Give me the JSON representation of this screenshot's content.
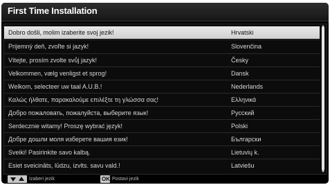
{
  "title": "First Time Installation",
  "languages": [
    {
      "welcome": "Dobro došli, molim izaberite svoj jezik!",
      "language": "Hrvatski",
      "selected": true
    },
    {
      "welcome": "Prijemný deň, zvoľte si jazyk!",
      "language": "Slovenčina"
    },
    {
      "welcome": "Vítejte, prosím zvolte svůj jazyk!",
      "language": "Česky"
    },
    {
      "welcome": "Velkommen, vælg venligst et sprog!",
      "language": "Dansk"
    },
    {
      "welcome": "Welkom, selecteer uw taal A.U.B.!",
      "language": "Nederlands"
    },
    {
      "welcome": "Καλώς ήλθατε, παρακαλούμε επιλέξτε τη γλώσσα σας!",
      "language": "Ελληνικά"
    },
    {
      "welcome": "Добро пожаловать, пожалуйста, выберите язык!",
      "language": "Русский"
    },
    {
      "welcome": "Serdecznie witamy! Proszę wybrać język!",
      "language": "Polski"
    },
    {
      "welcome": "Добре дошли моля изберете вашия език!",
      "language": "Български"
    },
    {
      "welcome": "Sveiki! Pasirinkite savo kalbą.",
      "language": "Lietuvių k."
    },
    {
      "welcome": "Esiet sveicināts, lūdzu, izvlts. savu vald.!",
      "language": "Latviešu"
    }
  ],
  "footer": {
    "select_hint": "Izaberi jezik",
    "ok_key": "OK",
    "confirm_hint": "Postavi jezik"
  },
  "icons": [
    "arrow-down-key-icon",
    "arrow-up-key-icon",
    "ok-key-icon"
  ],
  "colors": {
    "background": "#000000",
    "selected_row": "#dcdcdc",
    "text": "#d8d8d8"
  }
}
